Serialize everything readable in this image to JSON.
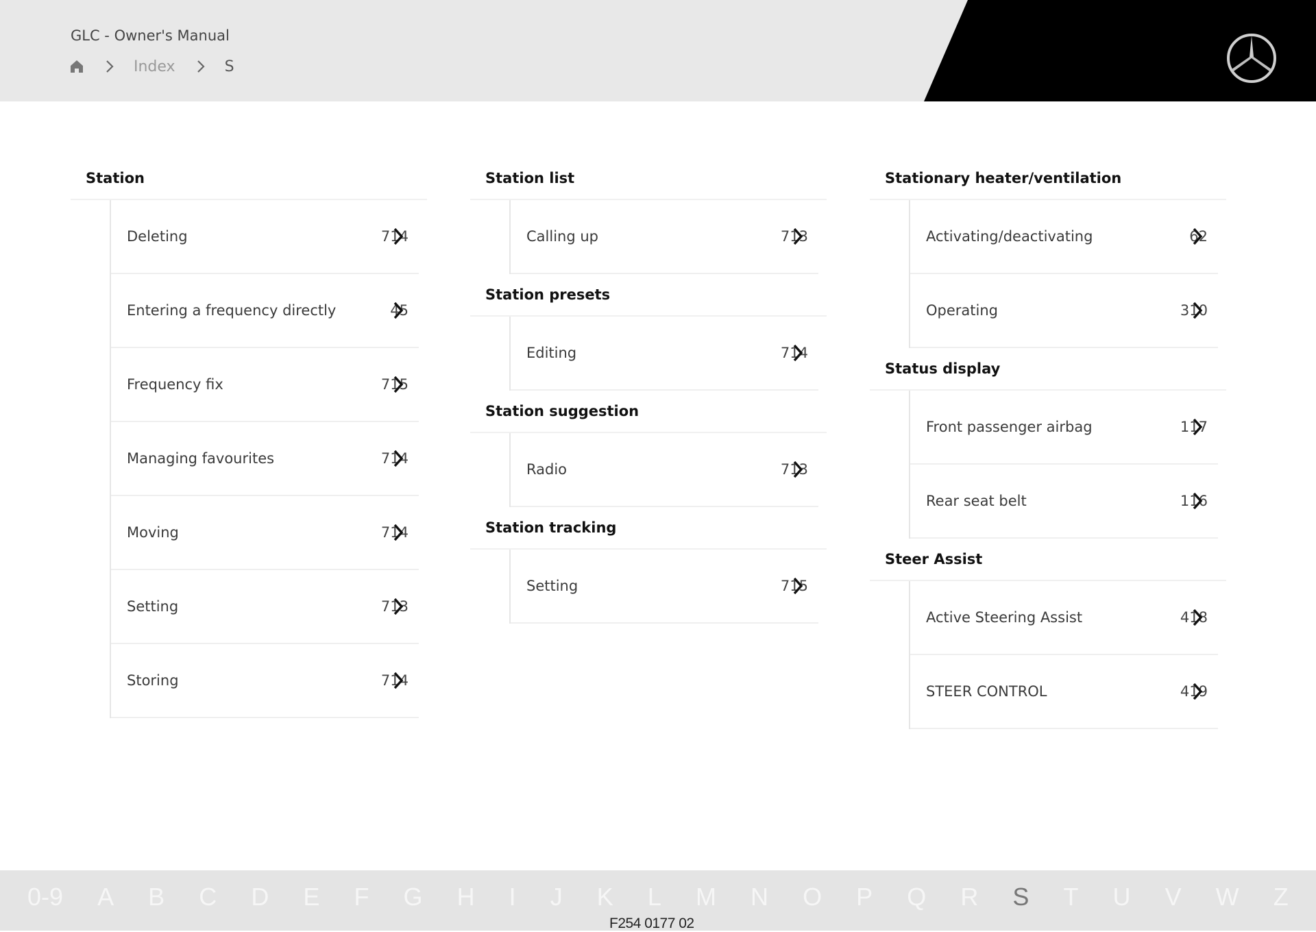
{
  "header": {
    "title": "GLC - Owner's Manual",
    "breadcrumb": [
      {
        "label": "home",
        "icon": "home-icon"
      },
      {
        "label": "Index"
      },
      {
        "label": "S"
      }
    ],
    "logo": "mercedes-star-logo",
    "accent_colors": {
      "header_bg": "#e8e8e8",
      "brand_black": "#000000"
    }
  },
  "columns": [
    {
      "sections": [
        {
          "heading": "Station",
          "items": [
            {
              "label": "Deleting",
              "page": "714"
            },
            {
              "label": "Entering a frequency directly",
              "page": "45"
            },
            {
              "label": "Frequency fix",
              "page": "715"
            },
            {
              "label": "Managing favourites",
              "page": "714"
            },
            {
              "label": "Moving",
              "page": "714"
            },
            {
              "label": "Setting",
              "page": "713"
            },
            {
              "label": "Storing",
              "page": "714"
            }
          ]
        }
      ]
    },
    {
      "sections": [
        {
          "heading": "Station list",
          "items": [
            {
              "label": "Calling up",
              "page": "713"
            }
          ]
        },
        {
          "heading": "Station presets",
          "items": [
            {
              "label": "Editing",
              "page": "714"
            }
          ]
        },
        {
          "heading": "Station suggestion",
          "items": [
            {
              "label": "Radio",
              "page": "713"
            }
          ]
        },
        {
          "heading": "Station tracking",
          "items": [
            {
              "label": "Setting",
              "page": "715"
            }
          ]
        }
      ]
    },
    {
      "sections": [
        {
          "heading": "Stationary heater/ventilation",
          "items": [
            {
              "label": "Activating/deactivating",
              "page": "62"
            },
            {
              "label": "Operating",
              "page": "310"
            }
          ]
        },
        {
          "heading": "Status display",
          "items": [
            {
              "label": "Front passenger airbag",
              "page": "117"
            },
            {
              "label": "Rear seat belt",
              "page": "116"
            }
          ]
        },
        {
          "heading": "Steer Assist",
          "items": [
            {
              "label": "Active Steering Assist",
              "page": "418"
            },
            {
              "label": "STEER CONTROL",
              "page": "419"
            }
          ]
        }
      ]
    }
  ],
  "footer": {
    "alphabet": [
      "0-9",
      "A",
      "B",
      "C",
      "D",
      "E",
      "F",
      "G",
      "H",
      "I",
      "J",
      "K",
      "L",
      "M",
      "N",
      "O",
      "P",
      "Q",
      "R",
      "S",
      "T",
      "U",
      "V",
      "W",
      "Z"
    ],
    "active": "S",
    "code": "F254 0177 02"
  }
}
